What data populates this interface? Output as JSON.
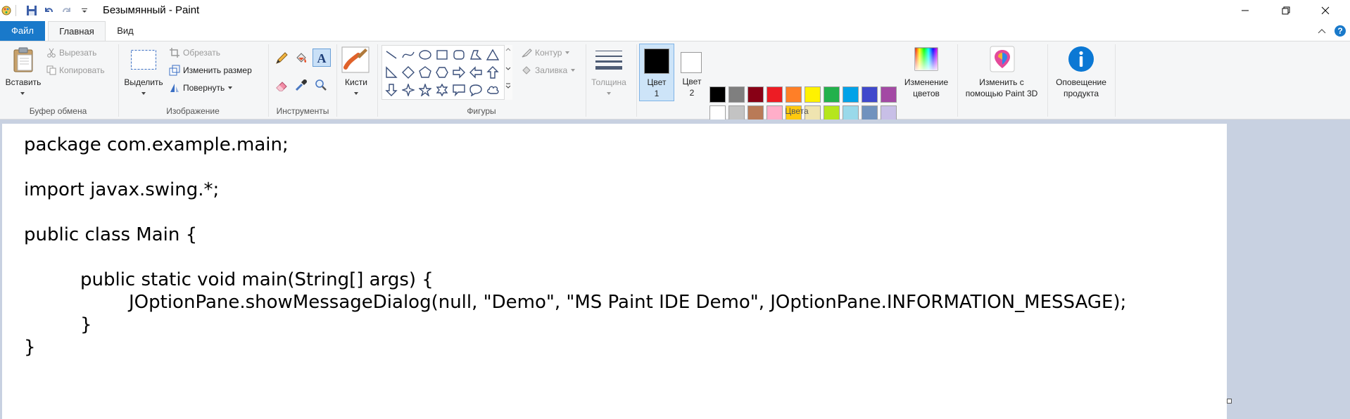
{
  "window": {
    "title": "Безымянный - Paint"
  },
  "tabs": {
    "file": "Файл",
    "home": "Главная",
    "view": "Вид"
  },
  "clipboard": {
    "paste": "Вставить",
    "cut": "Вырезать",
    "copy": "Копировать",
    "group": "Буфер обмена"
  },
  "image": {
    "select": "Выделить",
    "crop": "Обрезать",
    "resize": "Изменить размер",
    "rotate": "Повернуть",
    "group": "Изображение"
  },
  "tools": {
    "group": "Инструменты"
  },
  "brushes": {
    "label": "Кисти"
  },
  "shapes": {
    "outline": "Контур",
    "fill": "Заливка",
    "group": "Фигуры"
  },
  "size": {
    "label": "Толщина"
  },
  "colors": {
    "color1_line1": "Цвет",
    "color1_line2": "1",
    "color2_line1": "Цвет",
    "color2_line2": "2",
    "edit_line1": "Изменение",
    "edit_line2": "цветов",
    "group": "Цвета",
    "color1_value": "#000000",
    "color2_value": "#ffffff",
    "palette_row1": [
      "#000000",
      "#7f7f7f",
      "#880015",
      "#ed1c24",
      "#ff7f27",
      "#fff200",
      "#22b14c",
      "#00a2e8",
      "#3f48cc",
      "#a349a4"
    ],
    "palette_row2": [
      "#ffffff",
      "#c3c3c3",
      "#b97a57",
      "#ffaec9",
      "#ffc90e",
      "#efe4b0",
      "#b5e61d",
      "#99d9ea",
      "#7092be",
      "#c8bfe7"
    ]
  },
  "paint3d": {
    "line1": "Изменить с",
    "line2": "помощью Paint 3D"
  },
  "product": {
    "line1": "Оповещение",
    "line2": "продукта"
  },
  "code": [
    "package com.example.main;",
    "import javax.swing.*;",
    "public class Main {",
    "public static void main(String[] args) {",
    "JOptionPane.showMessageDialog(null, \"Demo\", \"MS Paint IDE Demo\", JOptionPane.INFORMATION_MESSAGE);",
    "}",
    "}"
  ]
}
